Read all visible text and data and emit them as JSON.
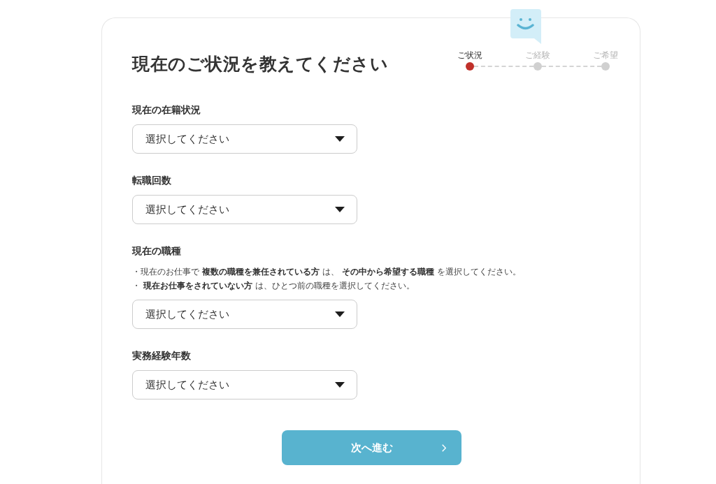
{
  "page": {
    "title": "現在のご状況を教えてください"
  },
  "steps": [
    {
      "label": "ご状況",
      "selected": true
    },
    {
      "label": "ご経験",
      "selected": false
    },
    {
      "label": "ご希望",
      "selected": false
    }
  ],
  "fields": [
    {
      "label": "現在の在籍状況",
      "placeholder": "選択してください"
    },
    {
      "label": "転職回数",
      "placeholder": "選択してください"
    },
    {
      "label": "現在の職種",
      "notes": [
        "・現在のお仕事で **複数の職種を兼任されている方** は、 **その中から希望する職種** を選択してください。",
        "・ **現在お仕事をされていない方** は、ひとつ前の職種を選択してください。"
      ],
      "placeholder": "選択してください"
    },
    {
      "label": "実務経験年数",
      "placeholder": "選択してください"
    }
  ],
  "next_button": {
    "label": "次へ進む"
  }
}
